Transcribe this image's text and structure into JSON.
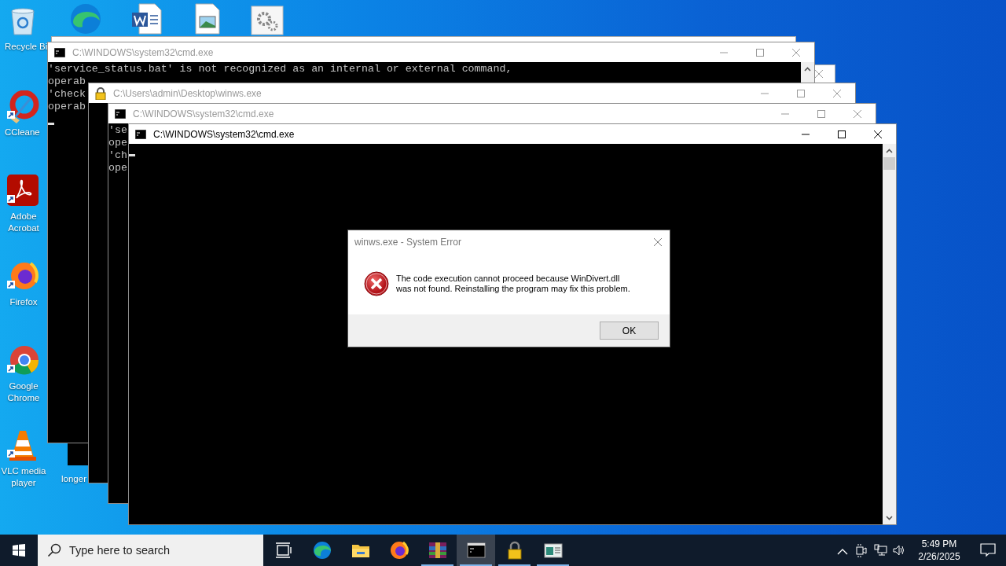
{
  "desktop_icons": [
    {
      "kind": "recycle",
      "label": "Recycle Bi"
    },
    {
      "kind": "ccleaner",
      "label": "CCleane"
    },
    {
      "kind": "acrobat",
      "label": "Adobe Acrobat"
    },
    {
      "kind": "firefox",
      "label": "Firefox"
    },
    {
      "kind": "chrome",
      "label": "Google Chrome"
    },
    {
      "kind": "vlc",
      "label": "VLC media player"
    },
    {
      "kind": "file",
      "label": "longer"
    },
    {
      "kind": "edge"
    },
    {
      "kind": "word"
    },
    {
      "kind": "image"
    },
    {
      "kind": "settings"
    }
  ],
  "windows": [
    {
      "kind": "cmd",
      "title": "C:\\WINDOWS\\system32\\cmd.exe",
      "active": false,
      "lines": [
        "'service_status.bat' is not recognized as an internal or external command,",
        "operab",
        "'check",
        "operab"
      ],
      "cursor": true
    },
    {
      "kind": "locked",
      "title": "C:\\Users\\admin\\Desktop\\winws.exe",
      "active": false,
      "cursor": false
    },
    {
      "kind": "cmd",
      "title": "C:\\WINDOWS\\system32\\cmd.exe",
      "active": false,
      "lines": [
        "'se",
        "ope",
        "'ch",
        "ope"
      ],
      "cursor": false
    },
    {
      "kind": "cmd",
      "title": "C:\\WINDOWS\\system32\\cmd.exe",
      "active": true,
      "cursor": true
    }
  ],
  "dialog": {
    "title": "winws.exe - System Error",
    "message_lines": [
      "The code execution cannot proceed because WinDivert.dll",
      "was not found. Reinstalling the program may fix this problem."
    ],
    "button": "OK"
  },
  "taskbar": {
    "search": {
      "placeholder": "Type here to search"
    },
    "apps": [
      {
        "kind": "taskview",
        "running": false,
        "selected": false
      },
      {
        "kind": "edge",
        "running": false,
        "selected": false
      },
      {
        "kind": "explorer",
        "running": false,
        "selected": false
      },
      {
        "kind": "firefox",
        "running": false,
        "selected": false
      },
      {
        "kind": "winrar",
        "running": true,
        "selected": false
      },
      {
        "kind": "cmd",
        "running": true,
        "selected": true
      },
      {
        "kind": "lock",
        "running": true,
        "selected": false
      },
      {
        "kind": "app",
        "running": true,
        "selected": false
      }
    ],
    "clock": {
      "time": "5:49 PM",
      "date": "2/26/2025"
    }
  }
}
